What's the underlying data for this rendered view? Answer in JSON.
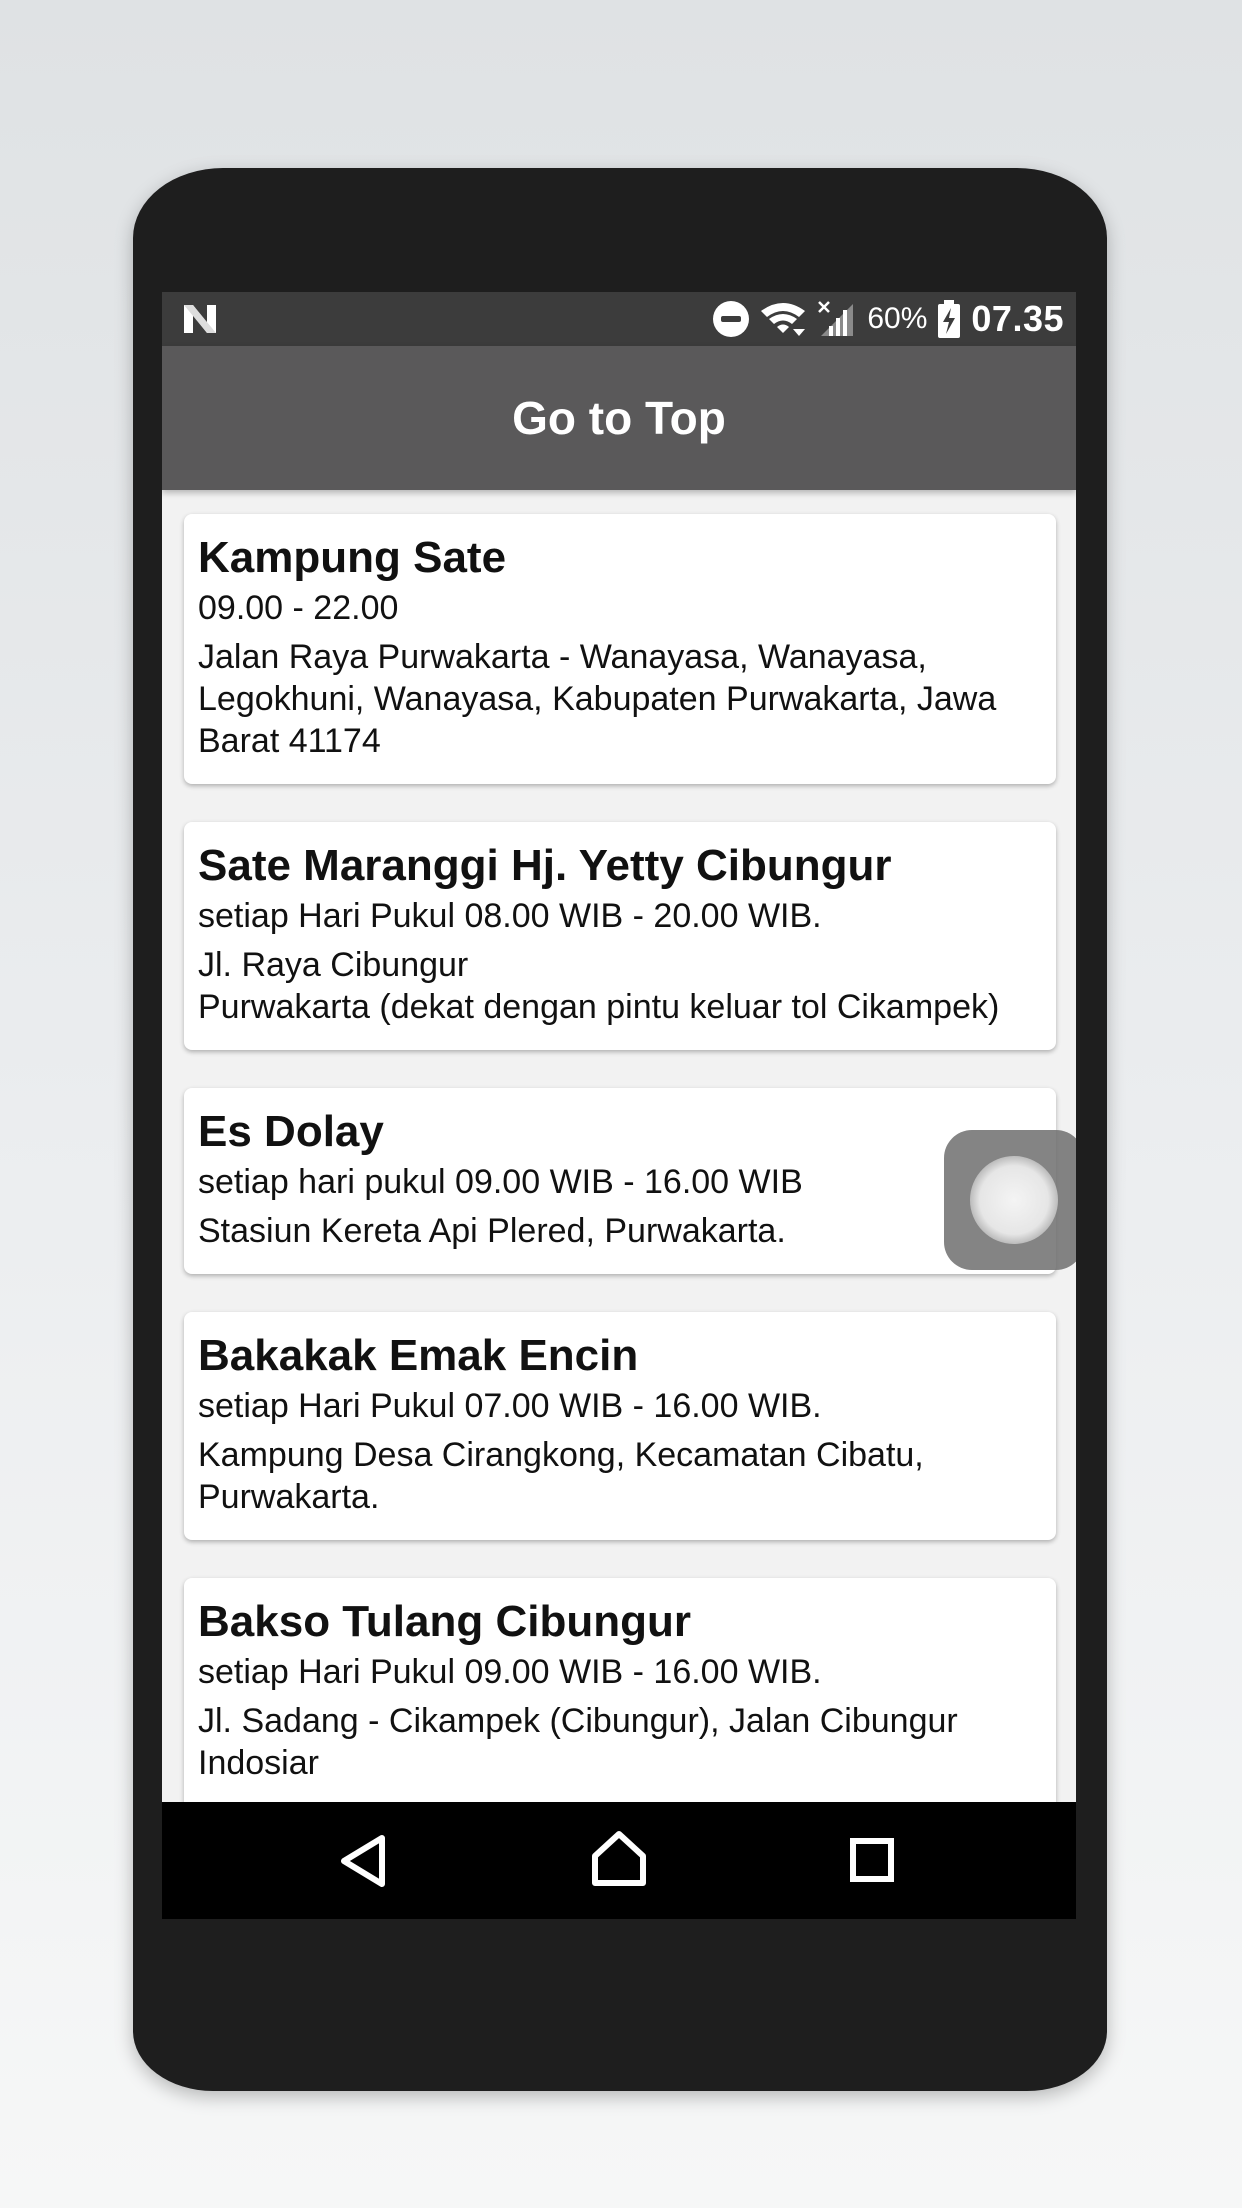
{
  "status_bar": {
    "left_icon": "n-logo-icon",
    "dnd_icon": "do-not-disturb-icon",
    "wifi_icon": "wifi-icon",
    "signal_icon": "cell-signal-icon",
    "battery_icon": "battery-charging-icon",
    "battery_percent": "60%",
    "time": "07.35"
  },
  "app_bar": {
    "title": "Go to Top"
  },
  "places": [
    {
      "name": "Kampung Sate",
      "hours": "09.00 - 22.00",
      "address": "Jalan Raya Purwakarta - Wanayasa, Wanayasa, Legokhuni, Wanayasa, Kabupaten Purwakarta, Jawa Barat 41174"
    },
    {
      "name": "Sate Maranggi Hj. Yetty Cibungur",
      "hours": "setiap Hari Pukul 08.00 WIB - 20.00 WIB.",
      "address": "Jl. Raya Cibungur\nPurwakarta (dekat dengan pintu keluar tol Cikampek)"
    },
    {
      "name": "Es Dolay",
      "hours": "setiap hari pukul 09.00 WIB - 16.00 WIB",
      "address": "Stasiun Kereta Api Plered, Purwakarta."
    },
    {
      "name": "Bakakak Emak Encin",
      "hours": "setiap Hari Pukul 07.00 WIB - 16.00 WIB.",
      "address": "Kampung Desa Cirangkong, Kecamatan Cibatu, Purwakarta."
    },
    {
      "name": "Bakso Tulang Cibungur",
      "hours": "setiap Hari Pukul 09.00 WIB - 16.00 WIB.",
      "address": "Jl. Sadang - Cikampek (Cibungur), Jalan Cibungur Indosiar"
    }
  ],
  "nav_bar": {
    "back_icon": "back-triangle-icon",
    "home_icon": "home-icon",
    "recents_icon": "recents-square-icon"
  }
}
